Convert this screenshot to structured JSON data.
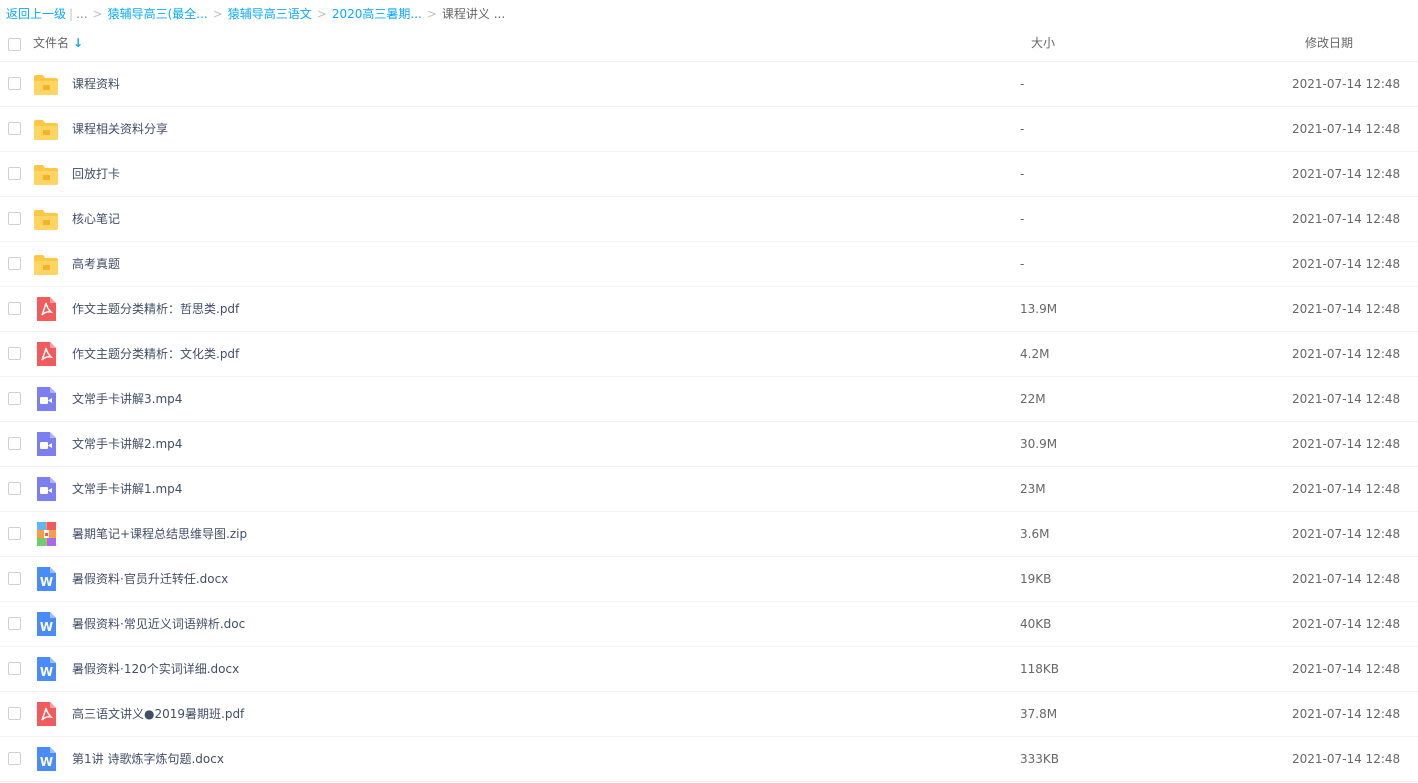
{
  "breadcrumb": {
    "back": "返回上一级",
    "ellipsis": "...",
    "items": [
      "猿辅导高三(最全...",
      "猿辅导高三语文",
      "2020高三暑期...",
      "课程讲义 ..."
    ]
  },
  "header": {
    "name_col": "文件名",
    "sort_arrow": "↓",
    "size_col": "大小",
    "date_col": "修改日期"
  },
  "files": [
    {
      "type": "folder",
      "icon": "folder-icon",
      "name": "课程资料",
      "size": "-",
      "date": "2021-07-14 12:48"
    },
    {
      "type": "folder",
      "icon": "folder-icon",
      "name": "课程相关资料分享",
      "size": "-",
      "date": "2021-07-14 12:48"
    },
    {
      "type": "folder",
      "icon": "folder-icon",
      "name": "回放打卡",
      "size": "-",
      "date": "2021-07-14 12:48"
    },
    {
      "type": "folder",
      "icon": "folder-icon",
      "name": "核心笔记",
      "size": "-",
      "date": "2021-07-14 12:48"
    },
    {
      "type": "folder",
      "icon": "folder-icon",
      "name": "高考真题",
      "size": "-",
      "date": "2021-07-14 12:48"
    },
    {
      "type": "pdf",
      "icon": "pdf-icon",
      "name": "作文主题分类精析：哲思类.pdf",
      "size": "13.9M",
      "date": "2021-07-14 12:48"
    },
    {
      "type": "pdf",
      "icon": "pdf-icon",
      "name": "作文主题分类精析：文化类.pdf",
      "size": "4.2M",
      "date": "2021-07-14 12:48"
    },
    {
      "type": "video",
      "icon": "video-icon",
      "name": "文常手卡讲解3.mp4",
      "size": "22M",
      "date": "2021-07-14 12:48"
    },
    {
      "type": "video",
      "icon": "video-icon",
      "name": "文常手卡讲解2.mp4",
      "size": "30.9M",
      "date": "2021-07-14 12:48"
    },
    {
      "type": "video",
      "icon": "video-icon",
      "name": "文常手卡讲解1.mp4",
      "size": "23M",
      "date": "2021-07-14 12:48"
    },
    {
      "type": "zip",
      "icon": "zip-icon",
      "name": "暑期笔记+课程总结思维导图.zip",
      "size": "3.6M",
      "date": "2021-07-14 12:48"
    },
    {
      "type": "word",
      "icon": "word-icon",
      "name": "暑假资料·官员升迁转任.docx",
      "size": "19KB",
      "date": "2021-07-14 12:48"
    },
    {
      "type": "word",
      "icon": "word-icon",
      "name": "暑假资料·常见近义词语辨析.doc",
      "size": "40KB",
      "date": "2021-07-14 12:48"
    },
    {
      "type": "word",
      "icon": "word-icon",
      "name": "暑假资料·120个实词详细.docx",
      "size": "118KB",
      "date": "2021-07-14 12:48"
    },
    {
      "type": "pdf",
      "icon": "pdf-icon",
      "name": "高三语文讲义●2019暑期班.pdf",
      "size": "37.8M",
      "date": "2021-07-14 12:48"
    },
    {
      "type": "word",
      "icon": "word-icon",
      "name": "第1讲 诗歌炼字炼句题.docx",
      "size": "333KB",
      "date": "2021-07-14 12:48"
    }
  ],
  "colors": {
    "link": "#09aaff",
    "folder": "#ffc742",
    "pdf": "#f25b5b",
    "video": "#7b7ff0",
    "word": "#4a8cf7"
  }
}
